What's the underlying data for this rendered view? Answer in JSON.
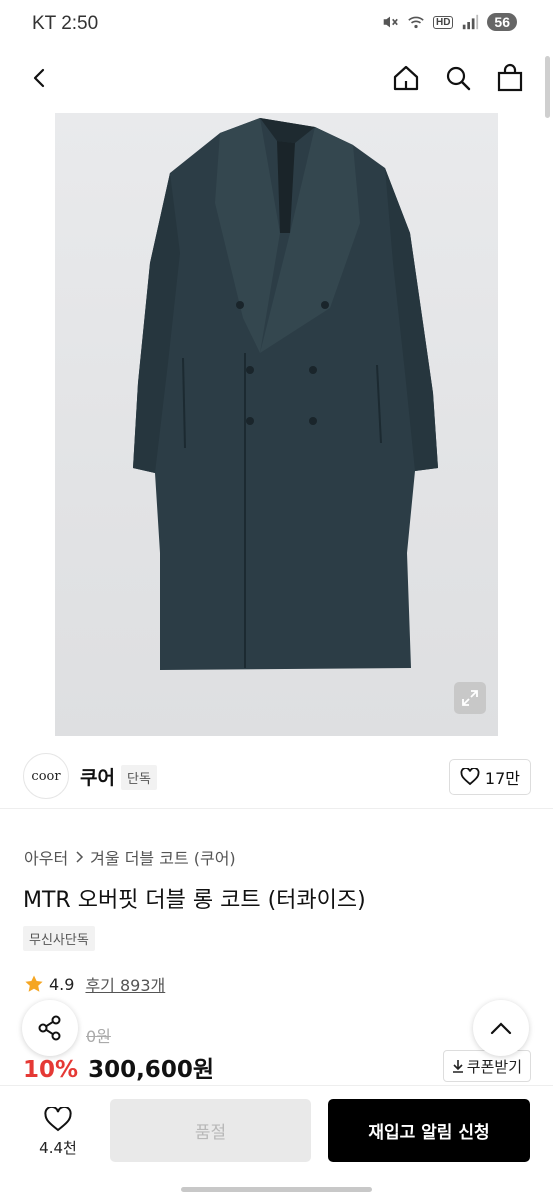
{
  "status_bar": {
    "carrier_time": "KT 2:50",
    "hd_label": "HD",
    "battery": "56",
    "icons": [
      "mute-icon",
      "wifi-icon",
      "hd-icon",
      "signal-icon"
    ]
  },
  "nav": {
    "icons": [
      "back-icon",
      "home-icon",
      "search-icon",
      "shopping-bag-icon"
    ]
  },
  "brand": {
    "logo_text": "coor",
    "name": "쿠어",
    "tag": "단독",
    "like_count": "17만"
  },
  "product": {
    "breadcrumb": [
      "아우터",
      "겨울 더블 코트 (쿠어)"
    ],
    "title": "MTR 오버핏 더블 롱 코트 (터콰이즈)",
    "exclusive_tag": "무신사단독",
    "rating": "4.9",
    "review_link": "후기 893개",
    "original_price": "0원",
    "discount": "10%",
    "sale_price": "300,600원",
    "coupon_label": "쿠폰받기"
  },
  "bottom_bar": {
    "wish_count": "4.4천",
    "soldout_label": "품절",
    "restock_label": "재입고 알림 신청"
  },
  "colors": {
    "discount": "#e53935",
    "coat": "#2c3d46",
    "star": "#f5a623"
  }
}
